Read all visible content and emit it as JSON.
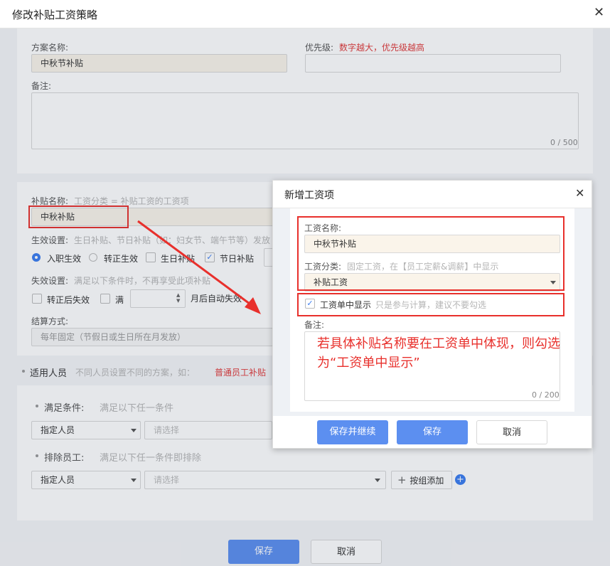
{
  "window": {
    "title": "修改补贴工资策略"
  },
  "plan": {
    "name_label": "方案名称:",
    "name_value": "中秋节补贴",
    "priority_label": "优先级:",
    "priority_hint": "数字越大，优先级越高",
    "remark_label": "备注:",
    "remark_counter": "0 / 500"
  },
  "allowance": {
    "name_label": "补贴名称:",
    "name_hint": "工资分类 = 补贴工资的工资项",
    "name_value": "中秋补贴",
    "effective_label": "生效设置:",
    "effective_hint": "生日补贴、节日补贴（如：妇女节、端午节等）发放",
    "radio_entry": "入职生效",
    "radio_regular": "转正生效",
    "check_birthday": "生日补贴",
    "check_festival": "节日补贴",
    "expire_label": "失效设置:",
    "expire_hint": "满足以下条件时，不再享受此项补贴",
    "check_after_regular": "转正后失效",
    "check_full": "满",
    "auto_expire": "月后自动失效",
    "settle_label": "结算方式:",
    "settle_value": "每年固定（节假日或生日所在月发放）"
  },
  "applicable": {
    "title": "适用人员",
    "hint": "不同人员设置不同的方案，如：",
    "hint_red": "普通员工补贴",
    "meet_label": "满足条件:",
    "meet_hint": "满足以下任一条件",
    "exclude_label": "排除员工:",
    "exclude_hint": "满足以下任一条件即排除",
    "select1": "指定人员",
    "placeholder1": "请选择",
    "select2": "指定人员",
    "placeholder2": "请选择",
    "add_group": "按组添加"
  },
  "footer": {
    "save": "保存",
    "cancel": "取消"
  },
  "modal": {
    "title": "新增工资项",
    "wage_name_label": "工资名称:",
    "wage_name_value": "中秋节补贴",
    "wage_type_label": "工资分类:",
    "wage_type_hint": "固定工资，在【员工定薪&调薪】中显示",
    "wage_type_value": "补贴工资",
    "show_in_payslip": "工资单中显示",
    "show_hint": "只是参与计算，建议不要勾选",
    "remark_label": "备注:",
    "remark_counter": "0 / 200",
    "annotation": "若具体补贴名称要在工资单中体现，则勾选为“工资单中显示”",
    "btn_save_continue": "保存并继续",
    "btn_save": "保存",
    "btn_cancel": "取消"
  },
  "colors": {
    "accent": "#5c8ff0",
    "annotation_red": "#e8302c"
  }
}
